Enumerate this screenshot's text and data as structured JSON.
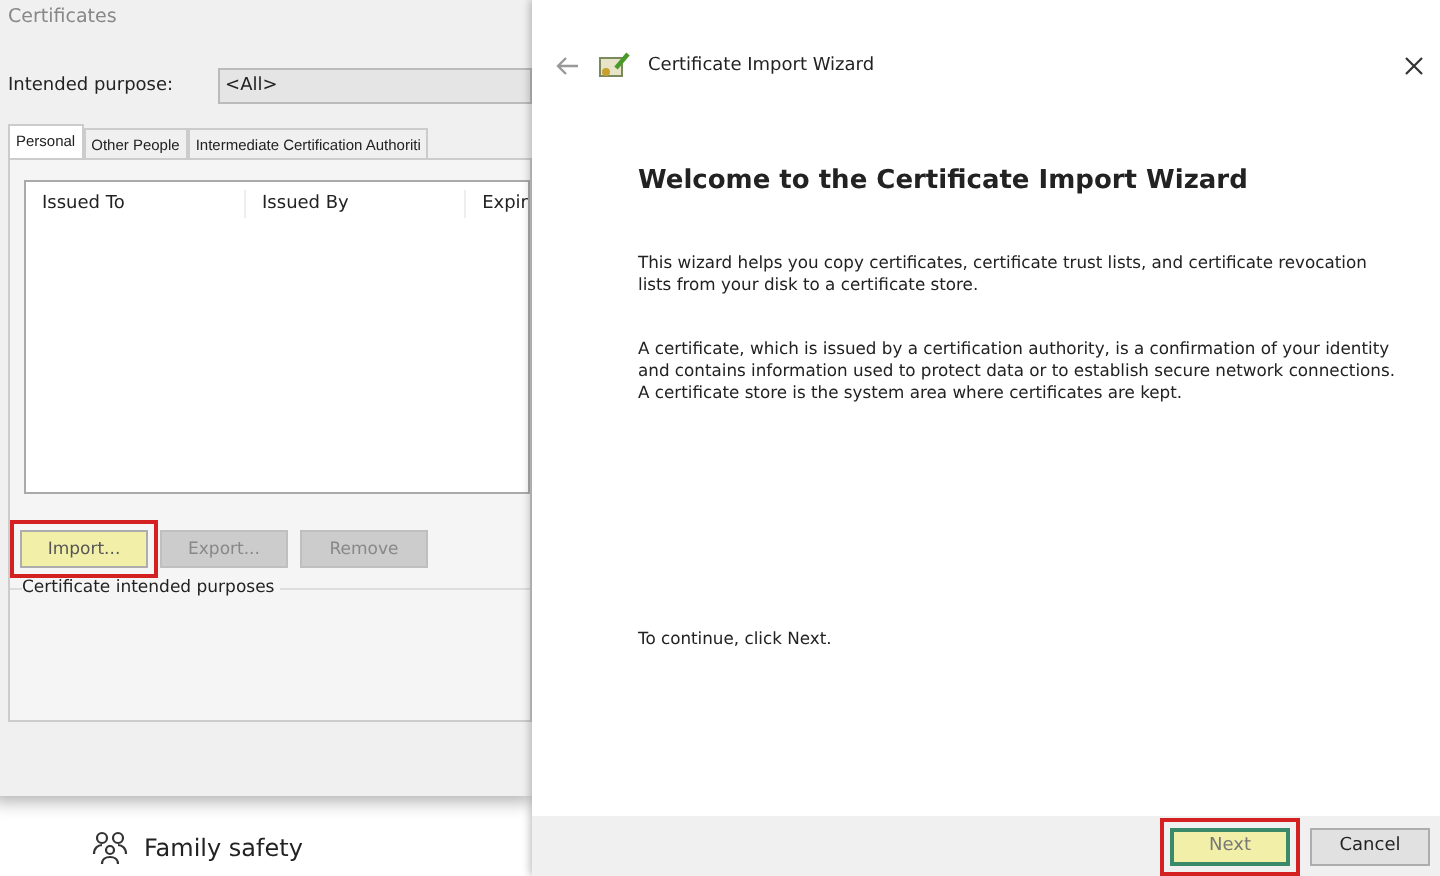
{
  "background": {
    "items": [
      {
        "kind": "family",
        "label": "Family safety"
      }
    ]
  },
  "certificates": {
    "title": "Certificates",
    "purpose_label": "Intended purpose:",
    "purpose_value": "<All>",
    "tabs": [
      {
        "label": "Personal",
        "selected": true
      },
      {
        "label": "Other People",
        "selected": false
      },
      {
        "label": "Intermediate Certification Authoriti",
        "selected": false
      }
    ],
    "columns": [
      "Issued To",
      "Issued By",
      "Expir"
    ],
    "buttons": [
      {
        "label": "Import...",
        "disabled": false,
        "highlighted": true
      },
      {
        "label": "Export...",
        "disabled": true,
        "highlighted": false
      },
      {
        "label": "Remove",
        "disabled": true,
        "highlighted": false
      }
    ],
    "group_label": "Certificate intended purposes"
  },
  "wizard": {
    "title": "Certificate Import Wizard",
    "heading": "Welcome to the Certificate Import Wizard",
    "paragraphs": [
      "This wizard helps you copy certificates, certificate trust lists, and certificate revocation lists from your disk to a certificate store.",
      "A certificate, which is issued by a certification authority, is a confirmation of your identity and contains information used to protect data or to establish secure network connections. A certificate store is the system area where certificates are kept."
    ],
    "continue_text": "To continue, click Next.",
    "buttons": [
      {
        "label": "Next",
        "highlighted": true
      },
      {
        "label": "Cancel",
        "highlighted": false
      }
    ]
  }
}
